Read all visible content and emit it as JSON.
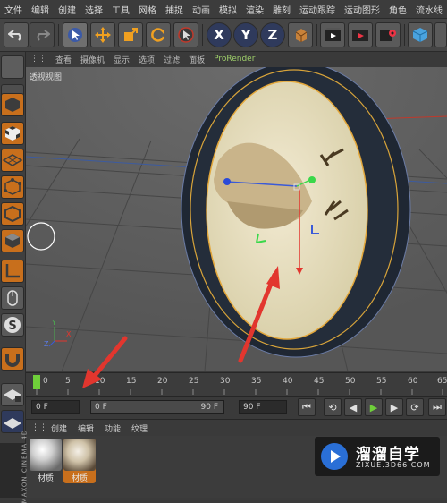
{
  "menu": [
    "文件",
    "编辑",
    "创建",
    "选择",
    "工具",
    "网格",
    "捕捉",
    "动画",
    "模拟",
    "渲染",
    "雕刻",
    "运动跟踪",
    "运动图形",
    "角色",
    "流水线"
  ],
  "toolbar": {
    "undo_icon": "undo-icon",
    "xyz": [
      "X",
      "Y",
      "Z"
    ]
  },
  "viewport": {
    "menu": [
      "查看",
      "摄像机",
      "显示",
      "选项",
      "过滤",
      "面板",
      "ProRender"
    ],
    "active_menu_index": 3,
    "label": "透视视图",
    "axis_y": "Y",
    "axis_x": "X",
    "axis_z": "Z"
  },
  "timeline": {
    "ticks": [
      "0",
      "5",
      "10",
      "15",
      "20",
      "25",
      "30",
      "35",
      "40",
      "45",
      "50",
      "55",
      "60",
      "65"
    ]
  },
  "transport": {
    "start_frame": "0 F",
    "range_start": "0 F",
    "range_end": "90 F",
    "end_frame": "90 F"
  },
  "materials": {
    "menu": [
      "创建",
      "编辑",
      "功能",
      "纹理"
    ],
    "items": [
      {
        "label": "材质"
      },
      {
        "label": "材质"
      }
    ]
  },
  "watermark": {
    "title": "溜溜自学",
    "subtitle": "ZIXUE.3D66.COM"
  },
  "brand": "MAXON CINEMA 4D",
  "colors": {
    "accent_orange": "#c86f1c",
    "active_menu": "#9fd06a",
    "arrow_red": "#e2362e"
  }
}
